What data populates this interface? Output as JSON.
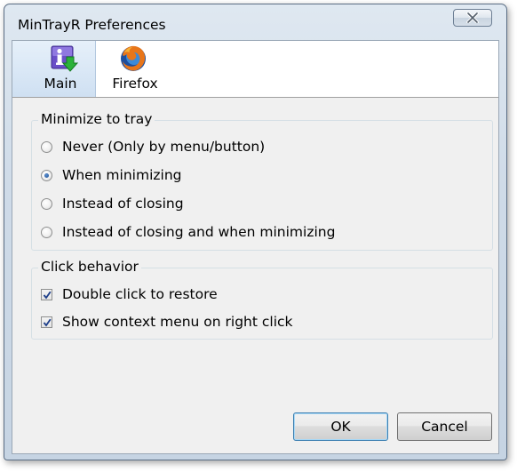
{
  "window": {
    "title": "MinTrayR Preferences",
    "close_icon": "close-icon"
  },
  "toolbar": {
    "tabs": [
      {
        "label": "Main",
        "icon": "info-download-icon",
        "selected": true
      },
      {
        "label": "Firefox",
        "icon": "firefox-icon",
        "selected": false
      }
    ]
  },
  "minimize_group": {
    "legend": "Minimize to tray",
    "options": [
      {
        "label": "Never (Only by menu/button)",
        "checked": false
      },
      {
        "label": "When minimizing",
        "checked": true
      },
      {
        "label": "Instead of closing",
        "checked": false
      },
      {
        "label": "Instead of closing and when minimizing",
        "checked": false
      }
    ]
  },
  "click_group": {
    "legend": "Click behavior",
    "options": [
      {
        "label": "Double click to restore",
        "checked": true
      },
      {
        "label": "Show context menu on right click",
        "checked": true
      }
    ]
  },
  "buttons": {
    "ok_label": "OK",
    "cancel_label": "Cancel"
  },
  "colors": {
    "accent": "#3c7fb1",
    "selected_tab": "#cfe0f2",
    "dialog_background": "#f0f0f0"
  }
}
